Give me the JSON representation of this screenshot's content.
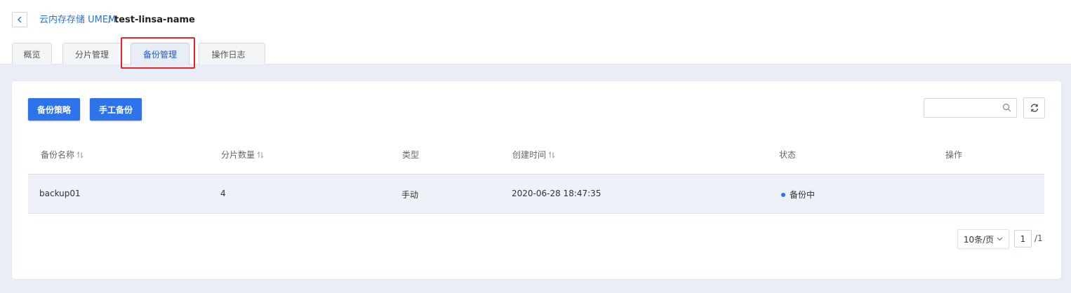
{
  "breadcrumb": {
    "parent": "云内存存储 UMEM",
    "separator": "/",
    "current": "test-linsa-name"
  },
  "tabs": [
    {
      "label": "概览",
      "active": false
    },
    {
      "label": "分片管理",
      "active": false
    },
    {
      "label": "备份管理",
      "active": true
    },
    {
      "label": "操作日志",
      "active": false
    }
  ],
  "toolbar": {
    "backup_policy_label": "备份策略",
    "manual_backup_label": "手工备份",
    "search_placeholder": ""
  },
  "table": {
    "columns": [
      "备份名称",
      "分片数量",
      "类型",
      "创建时间",
      "状态",
      "操作"
    ],
    "rows": [
      {
        "name": "backup01",
        "shards": "4",
        "type": "手动",
        "created": "2020-06-28 18:47:35",
        "status": "备份中",
        "actions": ""
      }
    ]
  },
  "pagination": {
    "page_size": "10条/页",
    "current_page": "1",
    "total": "/1"
  },
  "colors": {
    "primary": "#2d73ea",
    "link": "#2a6fe0",
    "highlight": "#e8242a",
    "page_bg": "#e9edf5",
    "row_bg": "#eef1f8"
  }
}
